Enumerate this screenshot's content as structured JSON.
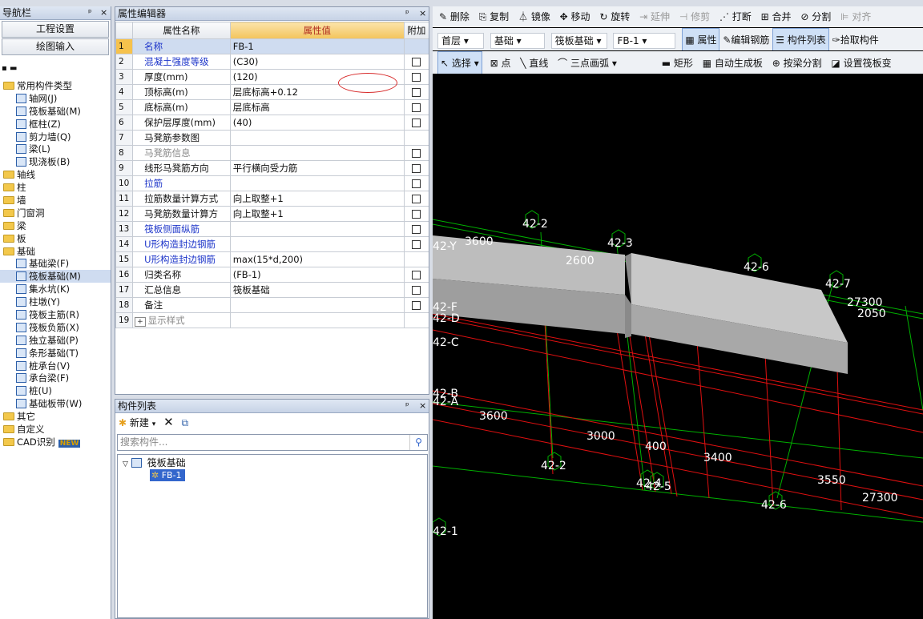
{
  "nav": {
    "title": "导航栏",
    "pin": "ᵖ",
    "close": "×",
    "btn_project": "工程设置",
    "btn_draw": "绘图输入",
    "tree": [
      {
        "label": "常用构件类型",
        "level": 0,
        "type": "folder"
      },
      {
        "label": "轴网(J)",
        "level": 1,
        "type": "item"
      },
      {
        "label": "筏板基础(M)",
        "level": 1,
        "type": "item"
      },
      {
        "label": "框柱(Z)",
        "level": 1,
        "type": "item"
      },
      {
        "label": "剪力墙(Q)",
        "level": 1,
        "type": "item"
      },
      {
        "label": "梁(L)",
        "level": 1,
        "type": "item"
      },
      {
        "label": "现浇板(B)",
        "level": 1,
        "type": "item"
      },
      {
        "label": "轴线",
        "level": 0,
        "type": "folder"
      },
      {
        "label": "柱",
        "level": 0,
        "type": "folder"
      },
      {
        "label": "墙",
        "level": 0,
        "type": "folder"
      },
      {
        "label": "门窗洞",
        "level": 0,
        "type": "folder"
      },
      {
        "label": "梁",
        "level": 0,
        "type": "folder"
      },
      {
        "label": "板",
        "level": 0,
        "type": "folder"
      },
      {
        "label": "基础",
        "level": 0,
        "type": "folder"
      },
      {
        "label": "基础梁(F)",
        "level": 1,
        "type": "item"
      },
      {
        "label": "筏板基础(M)",
        "level": 1,
        "type": "item",
        "selected": true
      },
      {
        "label": "集水坑(K)",
        "level": 1,
        "type": "item"
      },
      {
        "label": "柱墩(Y)",
        "level": 1,
        "type": "item"
      },
      {
        "label": "筏板主筋(R)",
        "level": 1,
        "type": "item"
      },
      {
        "label": "筏板负筋(X)",
        "level": 1,
        "type": "item"
      },
      {
        "label": "独立基础(P)",
        "level": 1,
        "type": "item"
      },
      {
        "label": "条形基础(T)",
        "level": 1,
        "type": "item"
      },
      {
        "label": "桩承台(V)",
        "level": 1,
        "type": "item"
      },
      {
        "label": "承台梁(F)",
        "level": 1,
        "type": "item"
      },
      {
        "label": "桩(U)",
        "level": 1,
        "type": "item"
      },
      {
        "label": "基础板带(W)",
        "level": 1,
        "type": "item"
      },
      {
        "label": "其它",
        "level": 0,
        "type": "folder"
      },
      {
        "label": "自定义",
        "level": 0,
        "type": "folder"
      },
      {
        "label": "CAD识别",
        "level": 0,
        "type": "folder",
        "badge": "NEW"
      }
    ]
  },
  "prop": {
    "title": "属性编辑器",
    "col_name": "属性名称",
    "col_value": "属性值",
    "col_extra": "附加",
    "rows": [
      {
        "n": "1",
        "name": "名称",
        "value": "FB-1",
        "style": "blue",
        "check": false,
        "checkbox": false
      },
      {
        "n": "2",
        "name": "混凝土强度等级",
        "value": "(C30)",
        "style": "blue",
        "checkbox": true
      },
      {
        "n": "3",
        "name": "厚度(mm)",
        "value": "(120)",
        "style": "",
        "checkbox": true
      },
      {
        "n": "4",
        "name": "顶标高(m)",
        "value": "层底标高+0.12",
        "style": "",
        "checkbox": true
      },
      {
        "n": "5",
        "name": "底标高(m)",
        "value": "层底标高",
        "style": "",
        "checkbox": true
      },
      {
        "n": "6",
        "name": "保护层厚度(mm)",
        "value": "(40)",
        "style": "",
        "checkbox": true
      },
      {
        "n": "7",
        "name": "马凳筋参数图",
        "value": "",
        "style": "",
        "checkbox": false
      },
      {
        "n": "8",
        "name": "马凳筋信息",
        "value": "",
        "style": "gray",
        "checkbox": true
      },
      {
        "n": "9",
        "name": "线形马凳筋方向",
        "value": "平行横向受力筋",
        "style": "",
        "checkbox": true
      },
      {
        "n": "10",
        "name": "拉筋",
        "value": "",
        "style": "blue",
        "checkbox": true
      },
      {
        "n": "11",
        "name": "拉筋数量计算方式",
        "value": "向上取整+1",
        "style": "",
        "checkbox": true
      },
      {
        "n": "12",
        "name": "马凳筋数量计算方",
        "value": "向上取整+1",
        "style": "",
        "checkbox": true
      },
      {
        "n": "13",
        "name": "筏板侧面纵筋",
        "value": "",
        "style": "blue",
        "checkbox": true
      },
      {
        "n": "14",
        "name": "U形构造封边钢筋",
        "value": "",
        "style": "blue",
        "checkbox": true
      },
      {
        "n": "15",
        "name": "U形构造封边钢筋",
        "value": "max(15*d,200)",
        "style": "blue",
        "checkbox": false
      },
      {
        "n": "16",
        "name": "归类名称",
        "value": "(FB-1)",
        "style": "",
        "checkbox": true
      },
      {
        "n": "17",
        "name": "汇总信息",
        "value": "筏板基础",
        "style": "",
        "checkbox": true
      },
      {
        "n": "18",
        "name": "备注",
        "value": "",
        "style": "",
        "checkbox": true
      },
      {
        "n": "19",
        "name": "显示样式",
        "value": "",
        "style": "gray",
        "checkbox": false,
        "expand": "+"
      }
    ]
  },
  "clist": {
    "title": "构件列表",
    "new_label": "新建",
    "search_placeholder": "搜索构件...",
    "tree_root": "筏板基础",
    "tree_child": "FB-1"
  },
  "toolbar1": [
    "删除",
    "复制",
    "镜像",
    "移动",
    "旋转",
    "延伸",
    "修剪",
    "打断",
    "合并",
    "分割",
    "对齐"
  ],
  "toolbar2": {
    "floor": "首层",
    "category": "基础",
    "type": "筏板基础",
    "item": "FB-1",
    "btns": [
      "属性",
      "编辑钢筋",
      "构件列表",
      "拾取构件"
    ]
  },
  "toolbar3": [
    "选择",
    "点",
    "直线",
    "三点画弧",
    "矩形",
    "自动生成板",
    "按梁分割",
    "设置筏板变"
  ],
  "canvas": {
    "axis_labels": [
      "42-2",
      "42-3",
      "42-6",
      "42-7",
      "42-2",
      "42-4",
      "42-5",
      "42-6",
      "42-1",
      "42-D",
      "42-C",
      "42-B",
      "42-A",
      "42-Y",
      "42-F"
    ],
    "dims": [
      "3600",
      "2600",
      "27300",
      "2050",
      "3600",
      "3000",
      "400",
      "3400",
      "3550",
      "27300"
    ]
  }
}
